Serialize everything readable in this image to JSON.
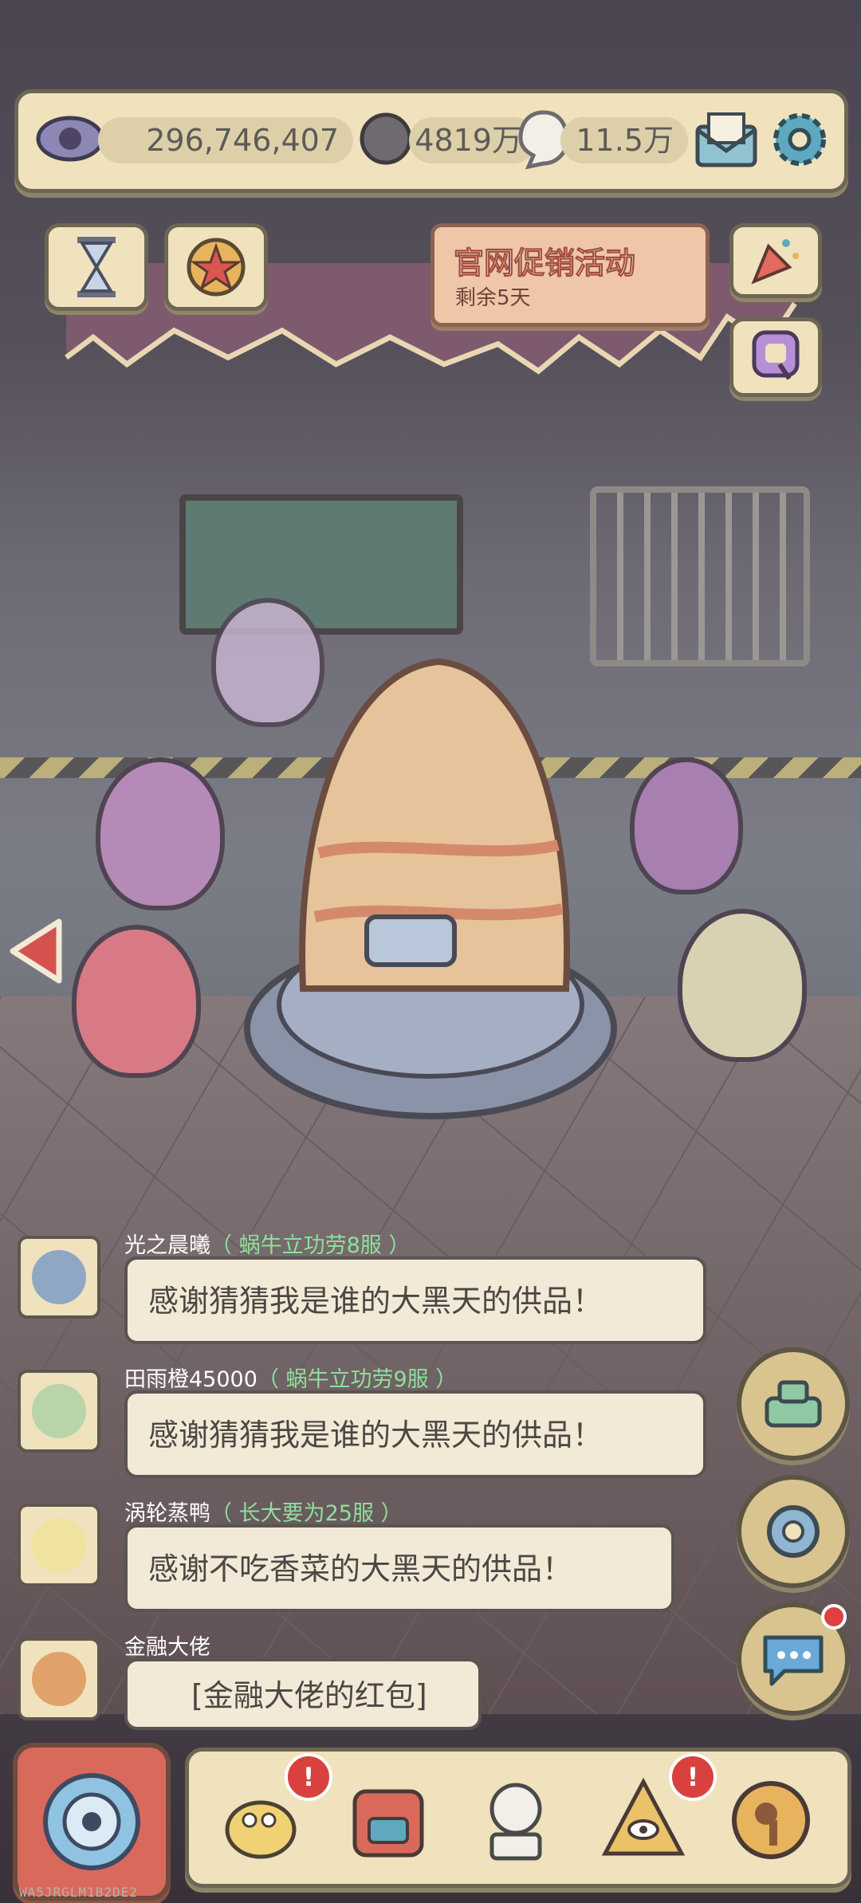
{
  "resources": {
    "eyes": "296,746,407",
    "dark_currency": "4819万",
    "light_currency": "11.5万"
  },
  "promo": {
    "title": "官网促销活动",
    "subtitle": "剩余5天"
  },
  "chat": [
    {
      "name": "光之晨曦",
      "server": "（ 蜗牛立功劳8服 ）",
      "message": "感谢猜猜我是谁的大黑天的供品！"
    },
    {
      "name": "田雨橙45000",
      "server": "（ 蜗牛立功劳9服 ）",
      "message": "感谢猜猜我是谁的大黑天的供品！"
    },
    {
      "name": "涡轮蒸鸭",
      "server": "（ 长大要为25服 ）",
      "message": "感谢不吃香菜的大黑天的供品！"
    },
    {
      "name": "金融大佬",
      "server": "",
      "message": "[金融大佬的红包]"
    }
  ],
  "badges": {
    "alert": "!"
  },
  "footer_code": "WA5JRGLM1B2DE2",
  "colors": {
    "panel": "#efe2bd",
    "border": "#6d6654",
    "server_green": "#8ee09a",
    "badge_red": "#d8413e"
  },
  "icons": [
    "eye-icon",
    "dark-coin-icon",
    "light-coin-icon",
    "mail-icon",
    "gear-icon",
    "hourglass-icon",
    "star-icon",
    "party-popper-icon",
    "q-icon",
    "left-arrow-icon",
    "tank-icon",
    "portal-icon",
    "chat-icon",
    "snail-portal-icon",
    "bird-icon",
    "backpack-icon",
    "statue-icon",
    "pyramid-eye-icon",
    "key-coin-icon"
  ]
}
